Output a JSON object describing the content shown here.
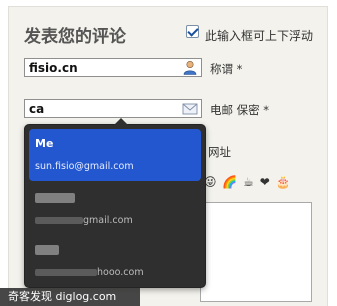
{
  "form": {
    "title": "发表您的评论",
    "float_option": {
      "label": "此输入框可上下浮动",
      "checked": true
    },
    "name_field": {
      "value": "fisio.cn",
      "label": "称谓 *",
      "icon": "user-icon"
    },
    "email_field": {
      "value": "ca",
      "label": "电邮 保密 *",
      "icon": "envelope-icon"
    },
    "url_label": "网址",
    "smileys": [
      "😜",
      "🌈",
      "☕",
      "❤",
      "🎂"
    ]
  },
  "autocomplete": {
    "selected_index": 0,
    "options": [
      {
        "name": "Me",
        "email": "sun.fisio@gmail.com",
        "obscured": false
      },
      {
        "name": "",
        "email_suffix": "gmail.com",
        "obscured": true
      },
      {
        "name": "",
        "email_suffix": "hooo.com",
        "obscured": true
      }
    ]
  },
  "watermark": "奇客发现 diglog.com",
  "colors": {
    "selected_bg": "#2357cf",
    "dropdown_bg": "#2f2f2f",
    "panel_bg": "#f3f2ec"
  }
}
